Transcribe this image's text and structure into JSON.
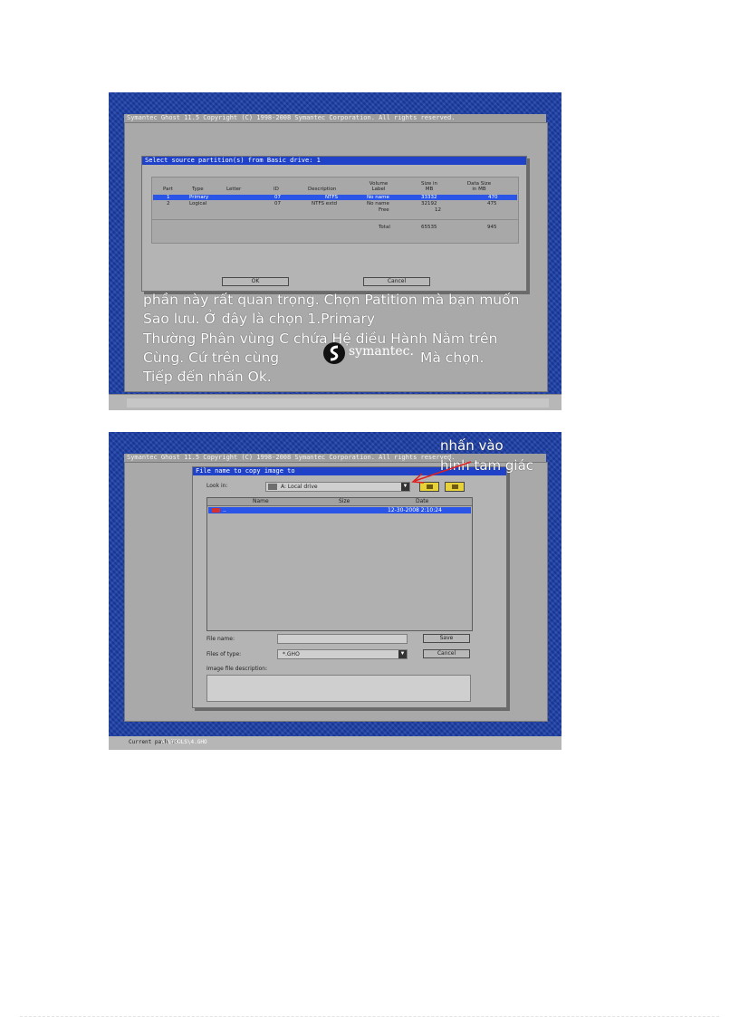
{
  "shot1": {
    "app_title": "Symantec Ghost 11.5   Copyright (C) 1998-2008 Symantec Corporation. All rights reserved.",
    "dialog_title": "Select source partition(s) from Basic drive: 1",
    "columns": [
      "Part",
      "Type",
      "Letter",
      "ID",
      "Description",
      "Volume Label",
      "Size in MB",
      "Data Size in MB"
    ],
    "rows": [
      {
        "part": "1",
        "type": "Primary",
        "letter": "",
        "id": "07",
        "description": "NTFS",
        "label": "No name",
        "size": "33332",
        "data_size": "470"
      },
      {
        "part": "2",
        "type": "Logical",
        "letter": "",
        "id": "07",
        "description": "NTFS extd",
        "label": "No name",
        "size": "32192",
        "data_size": "475"
      },
      {
        "part": "",
        "type": "",
        "letter": "",
        "id": "",
        "description": "",
        "label": "Free",
        "size": "12",
        "data_size": ""
      }
    ],
    "total_label": "Total",
    "total_size": "65535",
    "total_data_size": "945",
    "ok_label": "OK",
    "cancel_label": "Cancel",
    "overlay_lines": [
      "phần này rất quan trọng. Chọn Patition mà bạn muốn",
      "Sao lưu. Ở đây là chọn 1.Primary",
      "Thường Phân vùng C chứa Hệ điều Hành Nằm trên",
      "Cùng. Cứ trên cùng",
      "Mà chọn.",
      "Tiếp đến nhấn Ok."
    ],
    "logo_text": "symantec."
  },
  "shot2": {
    "app_title": "Symantec Ghost 11.5   Copyright (C) 1998-2008 Symantec Corporation. All rights reserved.",
    "dialog_title": "File name to copy image to",
    "look_in_label": "Look in:",
    "look_in_value": "A: Local drive",
    "col_name": "Name",
    "col_size": "Size",
    "col_date": "Date",
    "file_row_name": "..",
    "file_row_date": "12-30-2008 2:10:24",
    "file_name_label": "File name:",
    "file_name_value": "",
    "files_of_type_label": "Files of type:",
    "files_of_type_value": "*.GHO",
    "image_desc_label": "Image file description:",
    "save_label": "Save",
    "cancel_label": "Cancel",
    "current_path_label": "Current path is:",
    "current_path_value": "A:\\TOOLS\\4.GHO",
    "annotation_line1": "nhấn vào",
    "annotation_line2": "hình tam giác",
    "annotation_color": "#e02020"
  },
  "colors": {
    "background_blue": "#1b3ea8",
    "title_bar_blue": "#1f42c8",
    "selection_blue": "#2a55e6",
    "panel_gray": "#a9a9a9"
  }
}
